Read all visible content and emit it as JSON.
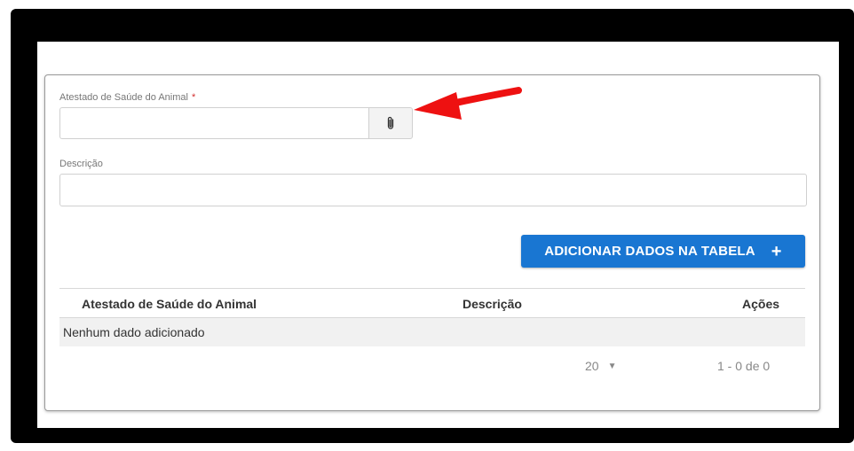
{
  "form": {
    "certificate_label": "Atestado de Saúde do Animal",
    "required_marker": "*",
    "certificate_value": "",
    "description_label": "Descrição",
    "description_value": ""
  },
  "add_button": {
    "label": "ADICIONAR DADOS NA TABELA",
    "icon": "+"
  },
  "table": {
    "columns": [
      "Atestado de Saúde do Animal",
      "Descrição",
      "Ações"
    ],
    "empty_text": "Nenhum dado adicionado"
  },
  "pagination": {
    "page_size": "20",
    "range": "1 - 0 de 0"
  },
  "colors": {
    "primary": "#1976d2",
    "required": "#d32f2f",
    "annotation_arrow": "#ee1111"
  },
  "icons": {
    "attach": "paperclip-icon",
    "page_size_caret": "caret-down-icon"
  }
}
